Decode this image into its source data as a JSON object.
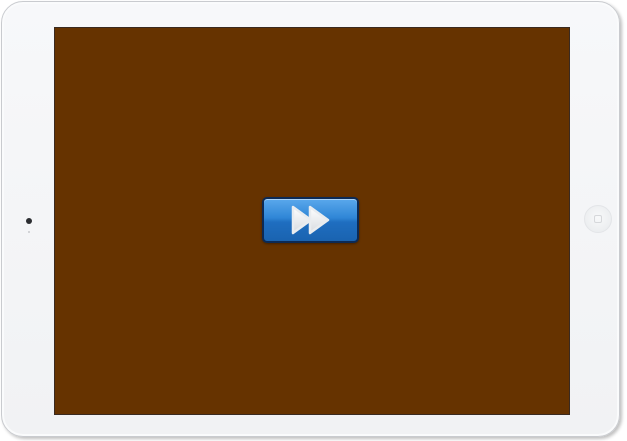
{
  "device": {
    "model": "ipad-landscape",
    "frame_color": "#f3f4f6"
  },
  "screen": {
    "background_color": "#663300"
  },
  "controls": {
    "fast_forward_button": {
      "icon": "fast-forward-icon",
      "accent_color": "#2f86d6"
    },
    "home_button": {
      "icon": "home-square-icon"
    }
  }
}
